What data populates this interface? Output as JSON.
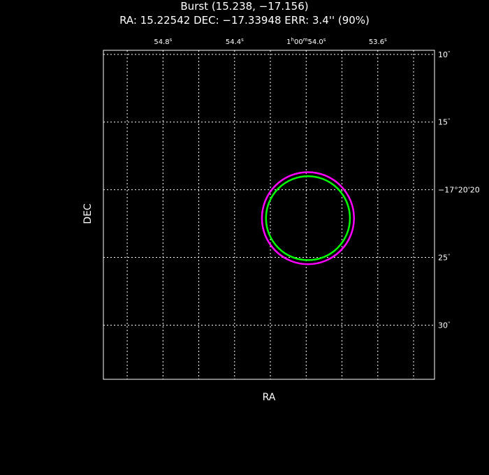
{
  "header": {
    "title": "Burst (15.238, −17.156)",
    "subtitle": "RA: 15.22542   DEC: −17.33948   ERR: 3.4'' (90%)"
  },
  "chart_data": {
    "type": "scatter",
    "title": "Burst (15.238, −17.156)",
    "subtitle": "RA: 15.22542   DEC: −17.33948   ERR: 3.4'' (90%)",
    "xlabel": "RA",
    "ylabel": "DEC",
    "grid": true,
    "x_unit": "seconds of time (RA 1h00m + s)",
    "y_unit": "arcsec (DEC −17°20' + \")",
    "xlim": [
      55.133,
      53.283
    ],
    "ylim": [
      34.0,
      9.7
    ],
    "x_grid": [
      55.0,
      54.8,
      54.6,
      54.4,
      54.2,
      54.0,
      53.8,
      53.6,
      53.4
    ],
    "y_grid": [
      10,
      15,
      20,
      25,
      30
    ],
    "x_ticks": [
      {
        "value": 54.8,
        "label": "54.8",
        "sup": "s"
      },
      {
        "value": 54.4,
        "label": "54.4",
        "sup": "s"
      },
      {
        "value": 54.0,
        "label": "1h00m54.0s",
        "pre": "1",
        "pre_sup": "h",
        "mid": "00",
        "mid_sup": "m",
        "main": "54.0",
        "sup": "s"
      },
      {
        "value": 53.6,
        "label": "53.6",
        "sup": "s"
      }
    ],
    "y_ticks": [
      {
        "value": 10,
        "label": "10\"",
        "main": "10",
        "sup": "\""
      },
      {
        "value": 15,
        "label": "15\"",
        "main": "15",
        "sup": "\""
      },
      {
        "value": 20,
        "label": "−17°20'20",
        "main": "−17°20'20",
        "sup": ""
      },
      {
        "value": 25,
        "label": "25\"",
        "main": "25",
        "sup": "\""
      },
      {
        "value": 30,
        "label": "30\"",
        "main": "30",
        "sup": "\""
      }
    ],
    "circles": [
      {
        "ra_s": 53.99,
        "dec_as": 22.1,
        "radius_as": 3.4,
        "color": "#ff00ff"
      },
      {
        "ra_s": 53.99,
        "dec_as": 22.1,
        "radius_as": 3.1,
        "color": "#00ff00"
      }
    ]
  },
  "colors": {
    "background": "#000000",
    "foreground": "#ffffff",
    "magenta": "#ff00ff",
    "green": "#00ff00"
  }
}
